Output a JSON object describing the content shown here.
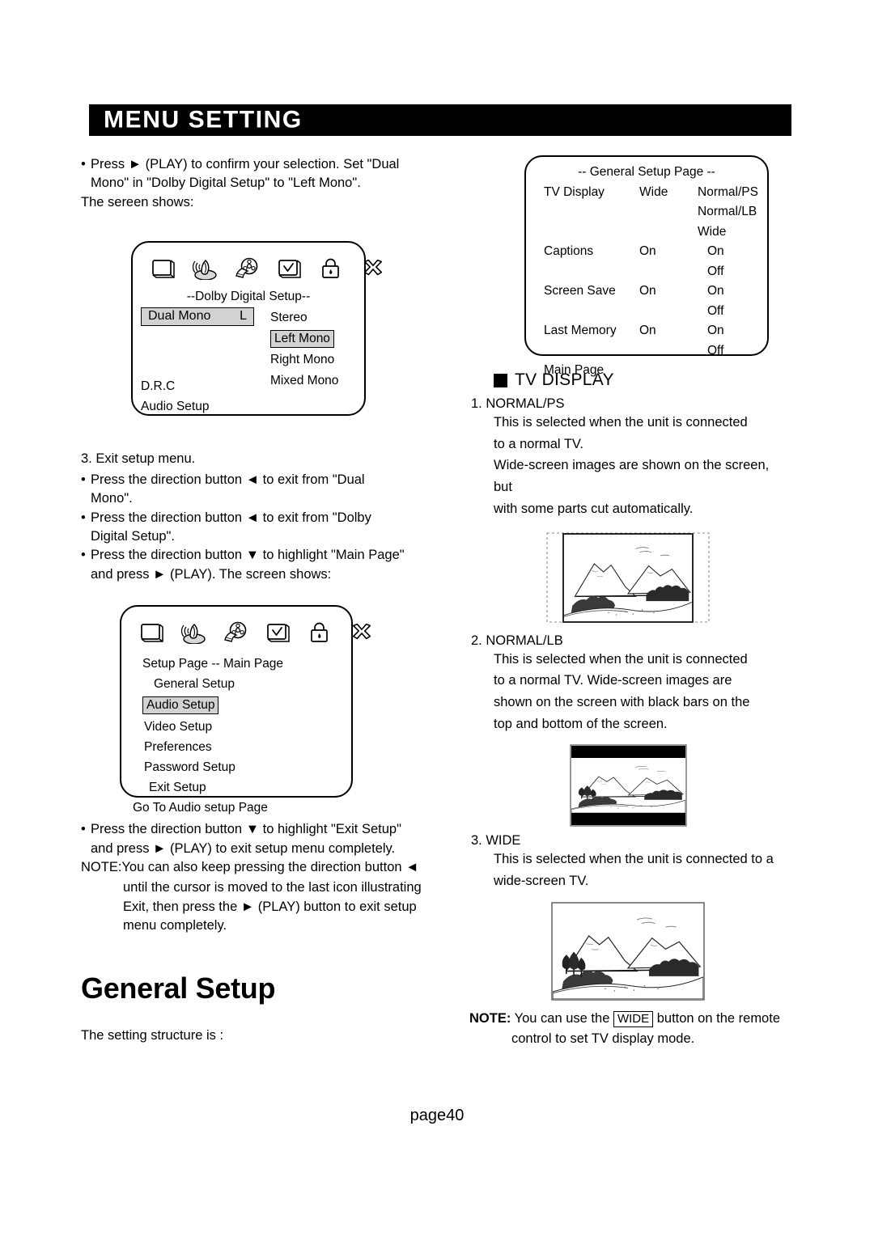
{
  "header": {
    "title": "MENU SETTING"
  },
  "footer": {
    "page_label": "page40"
  },
  "left": {
    "intro": {
      "bullet": "Press  ► (PLAY) to confirm your selection. Set \"Dual",
      "bullet_line2": "Mono\" in \"Dolby Digital Setup\" to \"Left Mono\".",
      "line3": "The sereen shows:"
    },
    "osd_dolby": {
      "icons": [
        "tv-icon",
        "speaker-icon",
        "film-reel-icon",
        "preferences-icon",
        "lock-icon",
        "exit-icon"
      ],
      "title": "--Dolby Digital Setup--",
      "row_label": "Dual Mono",
      "row_value": "L",
      "options": [
        "Stereo",
        "Left Mono",
        "Right Mono",
        "Mixed Mono"
      ],
      "selected_option": "Left Mono",
      "extra_rows": [
        "D.R.C",
        "Audio Setup"
      ]
    },
    "step3": {
      "heading": "3. Exit setup menu.",
      "b1_l1": "Press the direction button ◄ to exit from \"Dual",
      "b1_l2": "Mono\".",
      "b2_l1": "Press the direction button ◄ to exit from \"Dolby",
      "b2_l2": "Digital Setup\".",
      "b3_l1": "Press the direction button ▼ to highlight \"Main Page\"",
      "b3_l2": "and press ► (PLAY). The screen shows:"
    },
    "osd_main": {
      "icons": [
        "tv-icon",
        "speaker-icon",
        "film-reel-icon",
        "preferences-icon",
        "lock-icon",
        "exit-icon"
      ],
      "title": "Setup Page -- Main Page",
      "items": [
        "General Setup",
        "Audio Setup",
        "Video Setup",
        "Preferences",
        "Password Setup",
        "Exit Setup"
      ],
      "selected_item": "Audio Setup",
      "footer_line": "Go To Audio setup Page"
    },
    "after_main": {
      "b1_l1": "Press the direction button ▼ to highlight \"Exit Setup\"",
      "b1_l2": "and press ► (PLAY) to exit setup menu completely.",
      "note_l1": "NOTE:You can also keep pressing the direction button ◄",
      "note_l2": "until the cursor is moved to the last icon illustrating",
      "note_l3": "Exit, then press the ► (PLAY) button to exit setup",
      "note_l4": "menu completely."
    },
    "general_setup": {
      "heading": "General Setup",
      "sub": "The setting structure is :"
    }
  },
  "right": {
    "osd_general": {
      "title": "--  General Setup Page --",
      "rows": [
        {
          "label": "TV Display",
          "value": "Wide",
          "options": [
            "Normal/PS",
            "Normal/LB",
            "Wide"
          ]
        },
        {
          "label": "Captions",
          "value": "On",
          "options": [
            "On",
            "Off"
          ]
        },
        {
          "label": "Screen Save",
          "value": "On",
          "options": [
            "On",
            "Off"
          ]
        },
        {
          "label": "Last Memory",
          "value": "On",
          "options": [
            "On",
            "Off"
          ]
        }
      ],
      "footer_line": "Main Page"
    },
    "section": {
      "title": "TV DISPLAY"
    },
    "items": [
      {
        "num": "1. NORMAL/PS",
        "lines": [
          "This is selected when the unit is connected",
          "to a normal TV.",
          "Wide-screen images are shown on the screen, but",
          "with some parts cut automatically."
        ],
        "figure": "normal-ps-figure"
      },
      {
        "num": "2.  NORMAL/LB",
        "lines": [
          "This is selected when the unit is connected",
          "to a normal TV. Wide-screen images are",
          "shown on the screen with black bars on the",
          "top and bottom of the screen."
        ],
        "figure": "normal-lb-figure"
      },
      {
        "num": "3.  WIDE",
        "lines": [
          "This  is  selected  when  the  unit  is connected to a",
          "wide-screen TV."
        ],
        "figure": "wide-figure"
      }
    ],
    "note": {
      "prefix": "NOTE:",
      "text_before": " You can use the ",
      "key": "WIDE",
      "text_after": " button on the remote",
      "line2": "control to set TV display mode."
    }
  },
  "colors": {
    "banner_bg": "#000000",
    "banner_text": "#ffffff",
    "highlight_bg": "#d2d2d2",
    "text": "#000000",
    "page_bg": "#ffffff"
  }
}
